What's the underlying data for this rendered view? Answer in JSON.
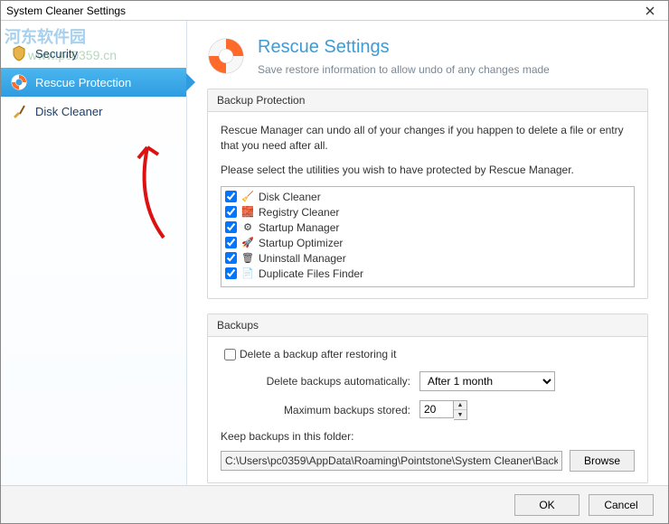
{
  "title": "System Cleaner Settings",
  "watermark": {
    "logo": "河东软件园",
    "url": "www.pc0359.cn"
  },
  "sidebar": {
    "items": [
      {
        "label": "Security",
        "icon": "shield"
      },
      {
        "label": "Rescue Protection",
        "icon": "lifebuoy"
      },
      {
        "label": "Disk Cleaner",
        "icon": "broom"
      }
    ],
    "selectedIndex": 1
  },
  "header": {
    "title": "Rescue Settings",
    "subtitle": "Save restore information to allow undo of any changes made"
  },
  "sections": {
    "backupProtection": {
      "title": "Backup Protection",
      "intro1": "Rescue Manager can undo all of your changes if you happen to delete a file or entry that you need after all.",
      "intro2": "Please select the utilities you wish to have protected by Rescue Manager.",
      "utilities": [
        {
          "label": "Disk Cleaner",
          "checked": true
        },
        {
          "label": "Registry Cleaner",
          "checked": true
        },
        {
          "label": "Startup Manager",
          "checked": true
        },
        {
          "label": "Startup Optimizer",
          "checked": true
        },
        {
          "label": "Uninstall Manager",
          "checked": true
        },
        {
          "label": "Duplicate Files Finder",
          "checked": true
        }
      ]
    },
    "backups": {
      "title": "Backups",
      "deleteAfterRestore": {
        "label": "Delete a backup after restoring it",
        "checked": false
      },
      "autoDelete": {
        "label": "Delete backups automatically:",
        "value": "After 1 month"
      },
      "maxStored": {
        "label": "Maximum backups stored:",
        "value": "20"
      },
      "folderLabel": "Keep backups in this folder:",
      "folderPath": "C:\\Users\\pc0359\\AppData\\Roaming\\Pointstone\\System Cleaner\\Back",
      "browse": "Browse"
    }
  },
  "footer": {
    "ok": "OK",
    "cancel": "Cancel"
  }
}
